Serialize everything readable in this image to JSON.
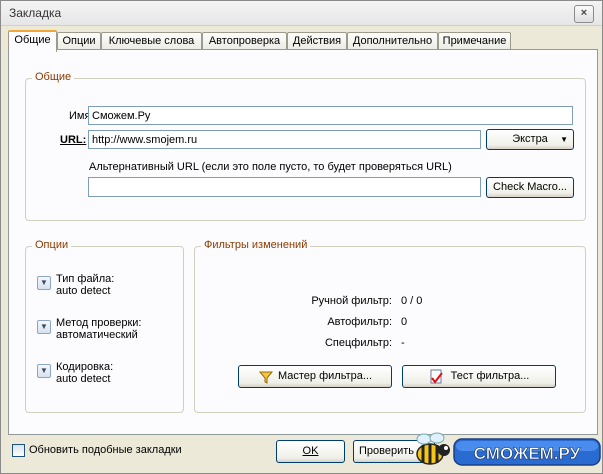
{
  "window": {
    "title": "Закладка",
    "close_label": "×"
  },
  "tabs": [
    {
      "label": "Общие",
      "active": true
    },
    {
      "label": "Опции"
    },
    {
      "label": "Ключевые слова"
    },
    {
      "label": "Автопроверка"
    },
    {
      "label": "Действия"
    },
    {
      "label": "Дополнительно"
    },
    {
      "label": "Примечание"
    }
  ],
  "general": {
    "title": "Общие",
    "name_label": "Имя:",
    "name_value": "Сможем.Ру",
    "url_label": "URL:",
    "url_value": "http://www.smojem.ru",
    "extra_button": "Экстра",
    "alt_url_label": "Альтернативный URL (если это поле пусто, то будет проверяться URL)",
    "alt_url_value": "",
    "check_macro_button": "Check Macro..."
  },
  "options": {
    "title": "Опции",
    "items": [
      {
        "line1": "Тип файла:",
        "line2": "auto detect"
      },
      {
        "line1": "Метод проверки:",
        "line2": "автоматический"
      },
      {
        "line1": "Кодировка:",
        "line2": "auto detect"
      }
    ]
  },
  "filters": {
    "title": "Фильтры изменений",
    "manual_label": "Ручной фильтр:",
    "manual_value": "0 / 0",
    "auto_label": "Автофильтр:",
    "auto_value": "0",
    "spec_label": "Спецфильтр:",
    "spec_value": "-",
    "wizard_button": "Мастер фильтра...",
    "test_button": "Тест фильтра..."
  },
  "footer": {
    "update_similar_label": "Обновить подобные закладки",
    "ok_button": "OK",
    "check_button": "Проверить",
    "watermark_text": "СМОЖЕМ.РУ"
  }
}
